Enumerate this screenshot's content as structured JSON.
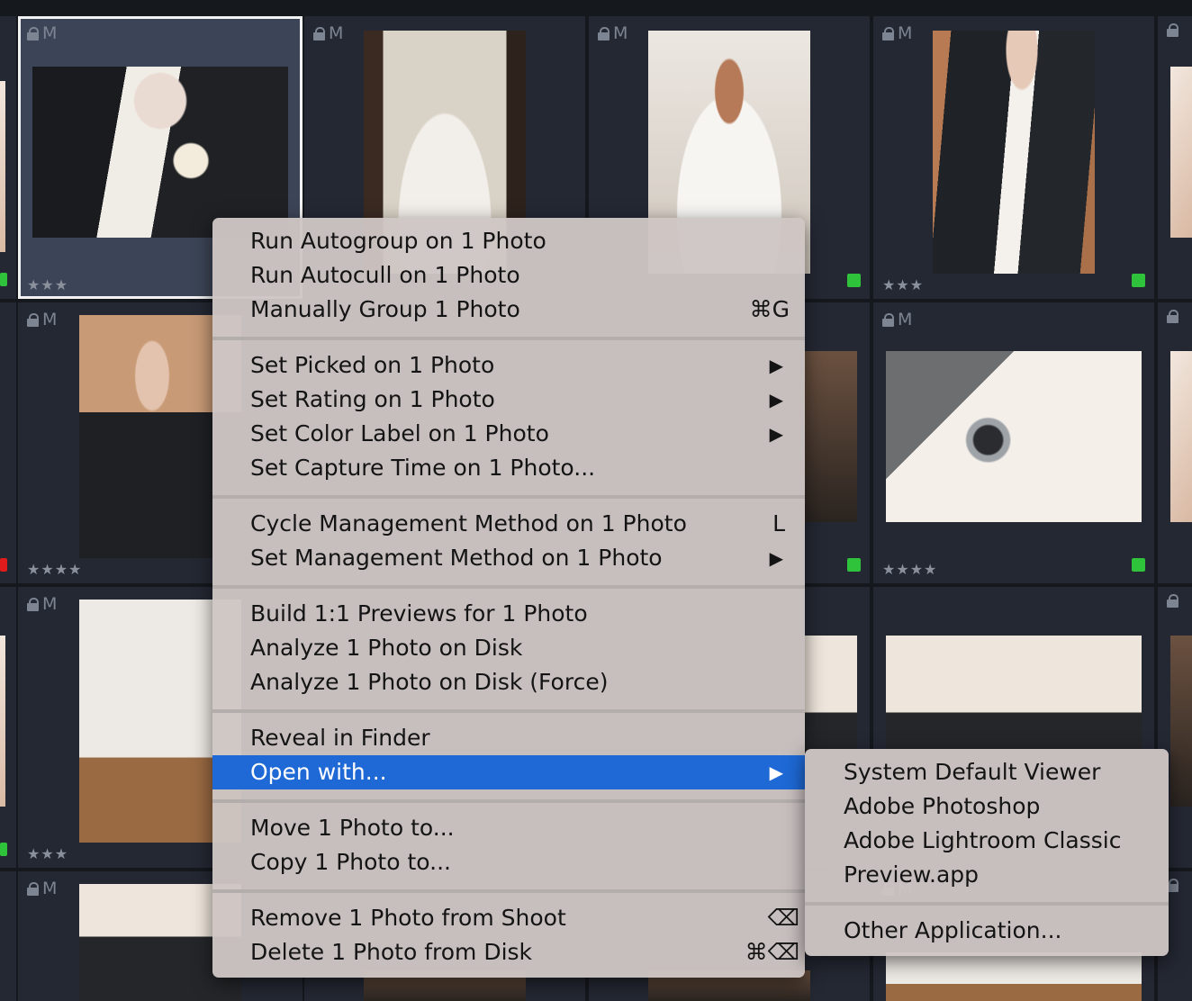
{
  "tiles": {
    "badge": "M",
    "stars3": "★★★",
    "stars4": "★★★★"
  },
  "colors": {
    "flag_green": "#2fc23b",
    "flag_red": "#e01b1b",
    "menu_highlight": "#1e69d6"
  },
  "context_menu": {
    "items": [
      {
        "label": "Run Autogroup on 1 Photo"
      },
      {
        "label": "Run Autocull on 1 Photo"
      },
      {
        "label": "Manually Group 1 Photo",
        "shortcut": "⌘G"
      },
      {
        "label": "Set Picked on 1 Photo",
        "submenu": "▶"
      },
      {
        "label": "Set Rating on 1 Photo",
        "submenu": "▶"
      },
      {
        "label": "Set Color Label on 1 Photo",
        "submenu": "▶"
      },
      {
        "label": "Set Capture Time on 1 Photo..."
      },
      {
        "label": "Cycle Management Method on 1 Photo",
        "shortcut": "L"
      },
      {
        "label": "Set Management Method on 1 Photo",
        "submenu": "▶"
      },
      {
        "label": "Build 1:1 Previews for 1 Photo"
      },
      {
        "label": "Analyze 1 Photo on Disk"
      },
      {
        "label": "Analyze 1 Photo on Disk (Force)"
      },
      {
        "label": "Reveal in Finder"
      },
      {
        "label": "Open with...",
        "submenu": "▶",
        "highlighted": true
      },
      {
        "label": "Move 1 Photo to..."
      },
      {
        "label": "Copy 1 Photo to..."
      },
      {
        "label": "Remove 1 Photo from Shoot",
        "shortcut": "⌫"
      },
      {
        "label": "Delete 1 Photo from Disk",
        "shortcut": "⌘⌫"
      }
    ]
  },
  "open_with_submenu": {
    "items": [
      {
        "label": "System Default Viewer"
      },
      {
        "label": "Adobe Photoshop"
      },
      {
        "label": "Adobe Lightroom Classic"
      },
      {
        "label": "Preview.app"
      },
      {
        "label": "Other Application..."
      }
    ]
  }
}
